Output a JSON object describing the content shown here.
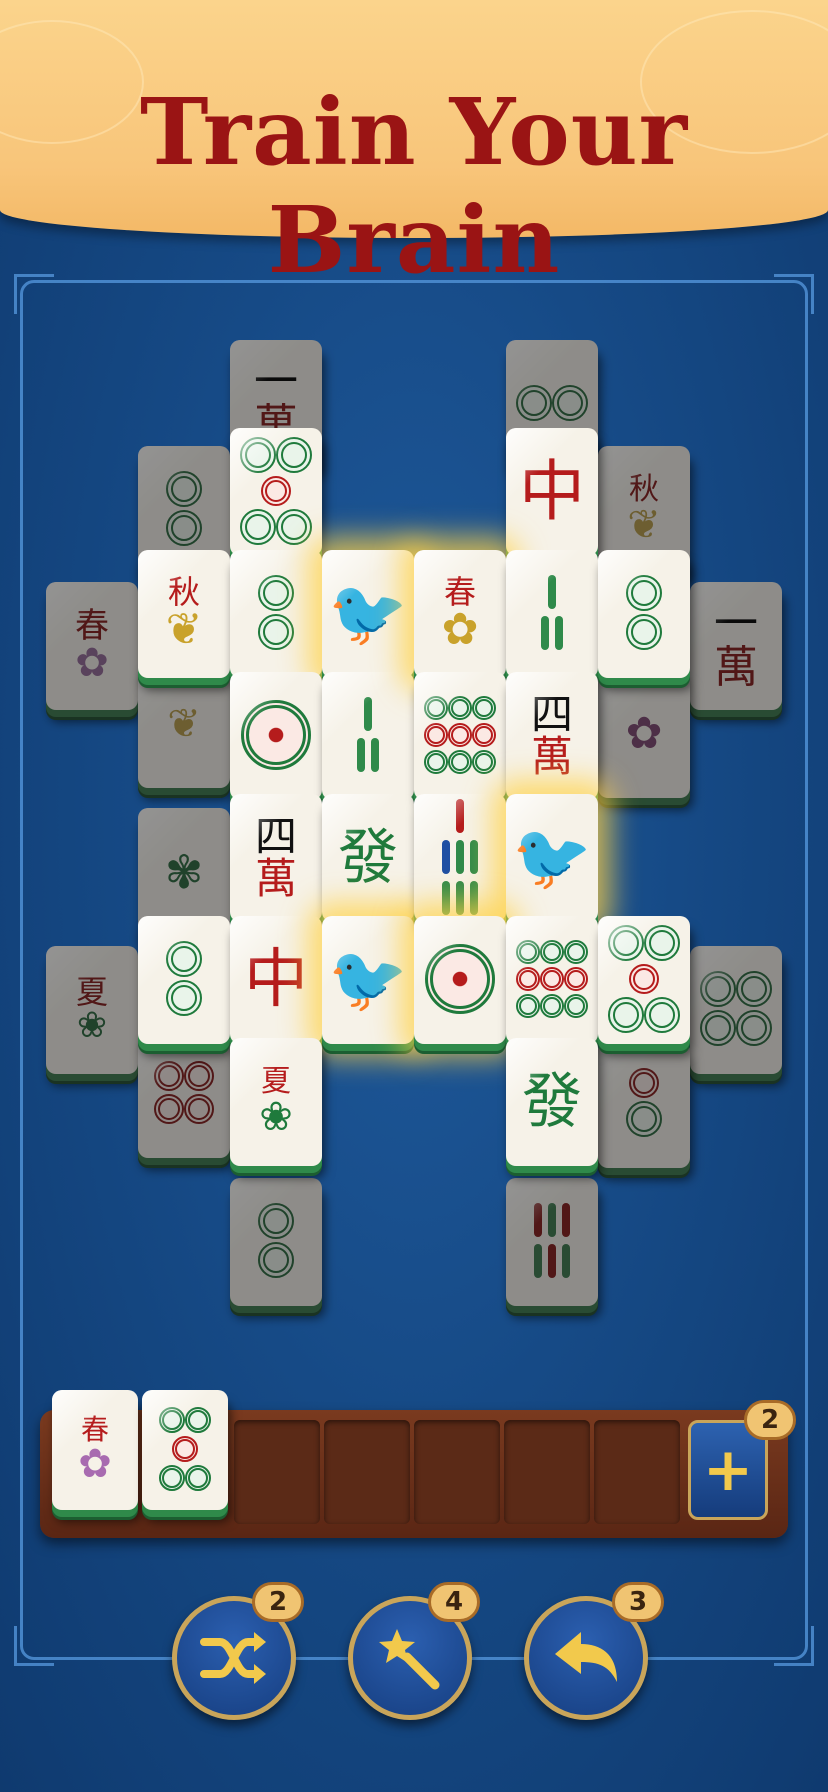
{
  "banner": {
    "title": "Train Your Brain"
  },
  "tiles": [
    {
      "glyph": "一\n萬",
      "kind": "char"
    },
    {
      "glyph": "⦿⦿",
      "kind": "dots"
    },
    {
      "glyph": "中",
      "kind": "red"
    },
    {
      "glyph": "秋",
      "kind": "season"
    },
    {
      "glyph": "春",
      "kind": "season"
    },
    {
      "glyph": "發",
      "kind": "green"
    },
    {
      "glyph": "四\n萬",
      "kind": "char"
    },
    {
      "glyph": "夏",
      "kind": "season"
    }
  ],
  "tray": {
    "tile_1": {
      "label": "春"
    },
    "tile_2": {
      "label": "dots"
    },
    "add_badge": "2"
  },
  "boosters": {
    "shuffle": {
      "badge": "2",
      "icon": "shuffle-icon"
    },
    "hint": {
      "badge": "4",
      "icon": "magic-wand-icon"
    },
    "undo": {
      "badge": "3",
      "icon": "undo-icon"
    }
  },
  "colors": {
    "accent": "#9a1414",
    "tile_edge": "#2f8a4a",
    "board_bg": "#164a86",
    "button_border": "#c9a55a"
  }
}
